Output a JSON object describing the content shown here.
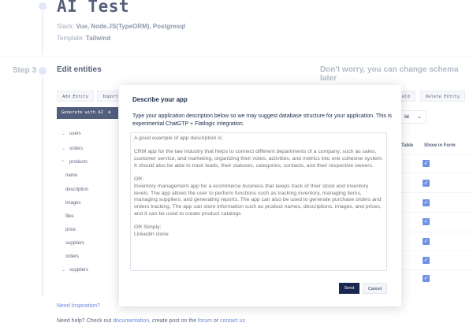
{
  "project": {
    "title": "AI Test",
    "stack_label": "Stack:",
    "stack_value": "Vue, Node.JS(TypeORM), Postgresql",
    "template_label": "Template:",
    "template_value": "Tailwind"
  },
  "step": {
    "label": "Step 3",
    "title": "Edit entities",
    "hint": "Don't worry, you can change schema later"
  },
  "toolbar": {
    "add_entity": "Add Entity",
    "import": "Import",
    "field": "eld",
    "delete_entity": "Delete Entity",
    "generate_ai": "Generate with AI"
  },
  "entities": [
    {
      "name": "users",
      "expanded": false
    },
    {
      "name": "orders",
      "expanded": false
    },
    {
      "name": "products",
      "expanded": true
    },
    {
      "name": "suppliers",
      "expanded": false
    }
  ],
  "product_fields": [
    "name",
    "description",
    "images",
    "files",
    "price",
    "suppliers",
    "orders"
  ],
  "table": {
    "select_value": "Id",
    "col_table": "Table",
    "col_show": "Show in Form"
  },
  "footer": {
    "inspiration": "Need Inspiration?",
    "help_prefix": "Need help? Check out",
    "documentation": "documentation",
    "help_mid": ", create post on the",
    "forum": "forum",
    "help_or": "or",
    "contact": "contact us"
  },
  "modal": {
    "title": "Describe your app",
    "description": "Type your application description below so we may suggest database structure for your application. This is experimental ChatGTP + Flatlogic integration.",
    "placeholder": "A good example of app description is:\n\nCRM app for the law industry that helps to connect different departments of a company, such as sales, customer service, and marketing, organizing their notes, activities, and metrics into one cohesive system. It should also be able to track leads, their statuses, categories, contacts, and their respective owners.\n\nOR:\nInventory management app for a ecommerce business that keeps track of their stock and inventory levels. The app allows the user to perform functions such as tracking inventory, managing items, managing suppliers, and generating reports. The app can also be used to generate purchase orders and orders tracking. The app can store information such as product names, descriptions, images, and prices, and it can be used to create product catalogs\n\nOR Simply:\nLinkedIn clone",
    "send": "Send",
    "cancel": "Cancel"
  }
}
